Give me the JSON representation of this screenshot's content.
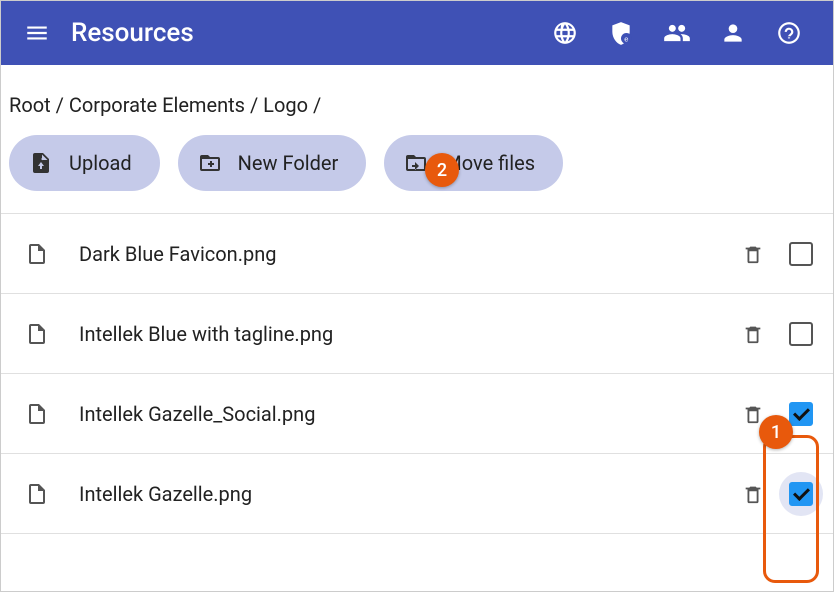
{
  "header": {
    "title": "Resources"
  },
  "breadcrumb": {
    "segments": [
      "Root",
      "Corporate Elements",
      "Logo"
    ],
    "separator": " / "
  },
  "actions": {
    "upload": "Upload",
    "new_folder": "New Folder",
    "move_files": "Move files"
  },
  "files": [
    {
      "name": "Dark Blue Favicon.png",
      "checked": false
    },
    {
      "name": "Intellek Blue with tagline.png",
      "checked": false
    },
    {
      "name": "Intellek Gazelle_Social.png",
      "checked": true
    },
    {
      "name": "Intellek Gazelle.png",
      "checked": true
    }
  ],
  "callouts": {
    "one": "1",
    "two": "2"
  }
}
